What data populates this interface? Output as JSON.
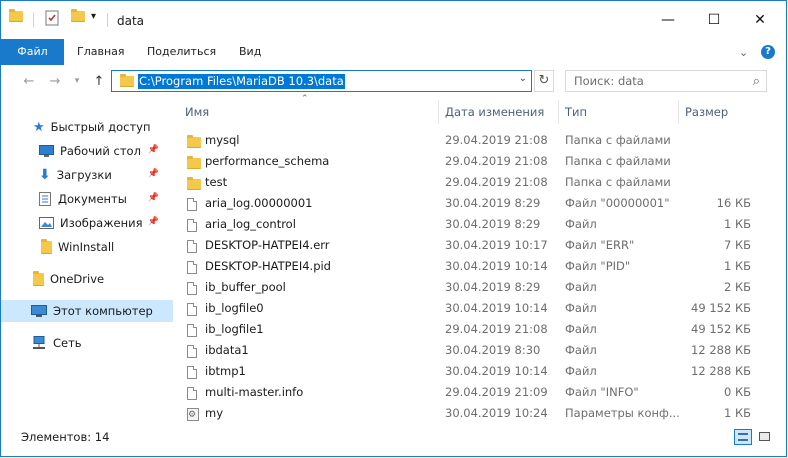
{
  "window": {
    "title": "data",
    "controls": {
      "minimize": "—",
      "maximize": "☐",
      "close": "✕"
    }
  },
  "ribbon": {
    "tabs": [
      "Файл",
      "Главная",
      "Поделиться",
      "Вид"
    ],
    "expand_icon": "chevron-down",
    "help": "?"
  },
  "address": {
    "path": "C:\\Program Files\\MariaDB 10.3\\data",
    "search_placeholder": "Поиск: data"
  },
  "nav_pane": {
    "items": [
      {
        "label": "Быстрый доступ",
        "icon": "star-icon",
        "pinned": false
      },
      {
        "label": "Рабочий стол",
        "icon": "desktop-icon",
        "pinned": true
      },
      {
        "label": "Загрузки",
        "icon": "download-icon",
        "pinned": true
      },
      {
        "label": "Документы",
        "icon": "documents-icon",
        "pinned": true
      },
      {
        "label": "Изображения",
        "icon": "pictures-icon",
        "pinned": true
      },
      {
        "label": "WinInstall",
        "icon": "folder-icon",
        "pinned": false
      },
      {
        "label": "OneDrive",
        "icon": "folder-icon",
        "pinned": false
      },
      {
        "label": "Этот компьютер",
        "icon": "computer-icon",
        "pinned": false,
        "selected": true
      },
      {
        "label": "Сеть",
        "icon": "network-icon",
        "pinned": false
      }
    ]
  },
  "columns": [
    "Имя",
    "Дата изменения",
    "Тип",
    "Размер"
  ],
  "files": [
    {
      "name": "mysql",
      "date": "29.04.2019 21:08",
      "type": "Папка с файлами",
      "size": "",
      "icon": "folder"
    },
    {
      "name": "performance_schema",
      "date": "29.04.2019 21:08",
      "type": "Папка с файлами",
      "size": "",
      "icon": "folder"
    },
    {
      "name": "test",
      "date": "29.04.2019 21:08",
      "type": "Папка с файлами",
      "size": "",
      "icon": "folder"
    },
    {
      "name": "aria_log.00000001",
      "date": "30.04.2019 8:29",
      "type": "Файл \"00000001\"",
      "size": "16 КБ",
      "icon": "file"
    },
    {
      "name": "aria_log_control",
      "date": "30.04.2019 8:29",
      "type": "Файл",
      "size": "1 КБ",
      "icon": "file"
    },
    {
      "name": "DESKTOP-HATPEI4.err",
      "date": "30.04.2019 10:17",
      "type": "Файл \"ERR\"",
      "size": "7 КБ",
      "icon": "file"
    },
    {
      "name": "DESKTOP-HATPEI4.pid",
      "date": "30.04.2019 10:14",
      "type": "Файл \"PID\"",
      "size": "1 КБ",
      "icon": "file"
    },
    {
      "name": "ib_buffer_pool",
      "date": "30.04.2019 8:29",
      "type": "Файл",
      "size": "2 КБ",
      "icon": "file"
    },
    {
      "name": "ib_logfile0",
      "date": "30.04.2019 10:14",
      "type": "Файл",
      "size": "49 152 КБ",
      "icon": "file"
    },
    {
      "name": "ib_logfile1",
      "date": "29.04.2019 21:08",
      "type": "Файл",
      "size": "49 152 КБ",
      "icon": "file"
    },
    {
      "name": "ibdata1",
      "date": "30.04.2019 8:30",
      "type": "Файл",
      "size": "12 288 КБ",
      "icon": "file"
    },
    {
      "name": "ibtmp1",
      "date": "30.04.2019 10:14",
      "type": "Файл",
      "size": "12 288 КБ",
      "icon": "file"
    },
    {
      "name": "multi-master.info",
      "date": "29.04.2019 21:09",
      "type": "Файл \"INFO\"",
      "size": "0 КБ",
      "icon": "file"
    },
    {
      "name": "my",
      "date": "30.04.2019 10:24",
      "type": "Параметры конф...",
      "size": "1 КБ",
      "icon": "config"
    }
  ],
  "status": {
    "items_count": "Элементов: 14"
  },
  "colors": {
    "accent": "#1979ca",
    "folder": "#f3c84b",
    "selection": "#0078d7"
  }
}
